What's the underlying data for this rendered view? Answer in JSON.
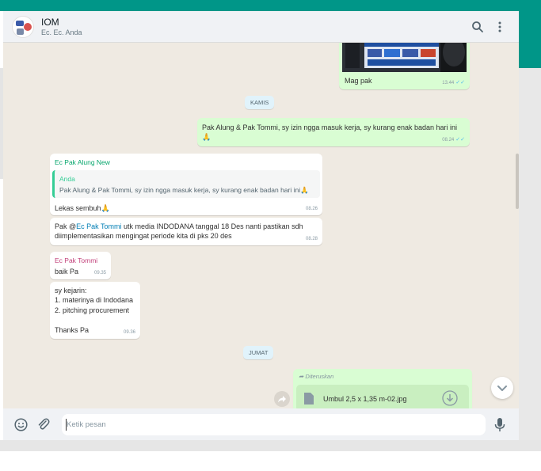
{
  "header": {
    "title": "IOM",
    "subtitle": "Ec. Ec. Anda",
    "icons": [
      "search-icon",
      "menu-icon"
    ]
  },
  "messages": {
    "image_caption": {
      "text": "Mag pak",
      "time": "13.44"
    },
    "date_kamis": "KAMIS",
    "out_izin": {
      "text": "Pak Alung & Pak Tommi, sy izin ngga masuk kerja, sy kurang enak badan hari ini 🙏",
      "time": "08.24"
    },
    "reply_alung": {
      "sender": "Ec Pak Alung New",
      "quote_name": "Anda",
      "quote_text": "Pak Alung & Pak Tommi, sy izin ngga masuk kerja, sy kurang enak badan hari ini🙏",
      "text": "Lekas sembuh🙏",
      "time": "08.26"
    },
    "alung_media": {
      "prefix": "Pak @",
      "mention": "Ec Pak Tommi",
      "rest": " utk media INDODANA tanggal 18 Des nanti pastikan sdh diimplementasikan mengingat periode kita di pks 20 des",
      "time": "08.28"
    },
    "tommi_baik": {
      "sender": "Ec Pak Tommi",
      "text": "baik Pa",
      "time": "09.35"
    },
    "tommi_kejarin": {
      "line1": "sy kejarin:",
      "line2": "1. materinya di Indodana",
      "line3": "2. pitching procurement",
      "line4": "Thanks Pa",
      "time": "09.36"
    },
    "date_jumat": "JUMAT",
    "forwarded": {
      "label": "Diteruskan",
      "filename": "Umbul 2,5 x 1,35 m-02.jpg"
    }
  },
  "footer": {
    "placeholder": "Ketik pesan",
    "icons": [
      "emoji-icon",
      "attach-icon",
      "mic-icon"
    ]
  },
  "colors": {
    "teal": "#009688",
    "chat_bg": "#efeae2",
    "outgoing": "#d9fdd3",
    "incoming": "#ffffff",
    "read_ticks": "#53bdeb"
  }
}
